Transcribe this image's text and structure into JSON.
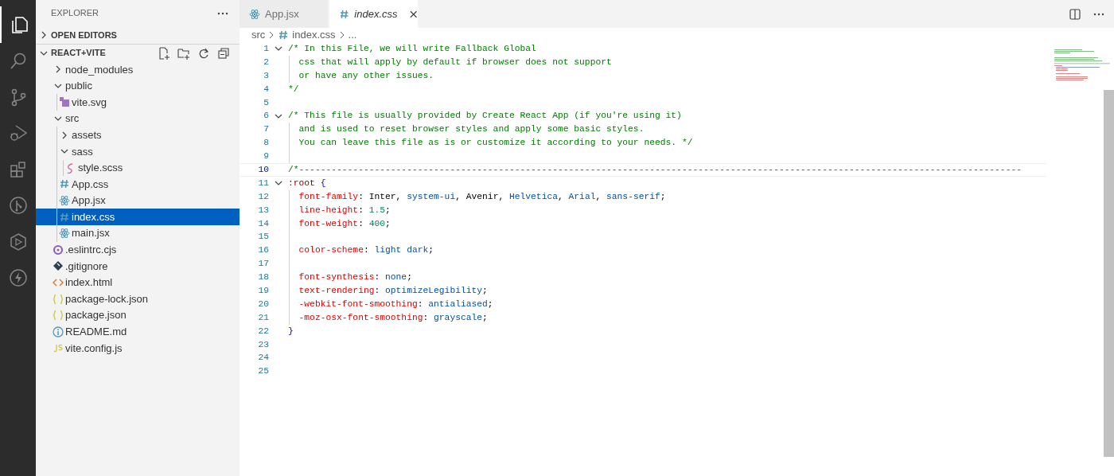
{
  "activity_bar": [
    {
      "kind": "files",
      "selected": true
    },
    {
      "kind": "search",
      "selected": false
    },
    {
      "kind": "source-control",
      "selected": false
    },
    {
      "kind": "run",
      "selected": false
    },
    {
      "kind": "extensions",
      "selected": false
    },
    {
      "kind": "git-graph",
      "selected": false
    },
    {
      "kind": "deploy",
      "selected": false
    },
    {
      "kind": "bolt",
      "selected": false
    }
  ],
  "sidebar": {
    "title": "EXPLORER",
    "sections": [
      {
        "label": "OPEN EDITORS",
        "expanded": false
      },
      {
        "label": "REACT+VITE",
        "expanded": true,
        "items": [
          {
            "label": "node_modules",
            "kind": "folder",
            "expanded": false,
            "selected": false
          },
          {
            "label": "public",
            "kind": "folder",
            "expanded": true,
            "selected": false,
            "children": [
              {
                "label": "vite.svg",
                "kind": "svg",
                "selected": false
              }
            ]
          },
          {
            "label": "src",
            "kind": "folder",
            "expanded": true,
            "selected": false,
            "children": [
              {
                "label": "assets",
                "kind": "folder",
                "expanded": false,
                "selected": false
              },
              {
                "label": "sass",
                "kind": "folder",
                "expanded": true,
                "selected": false,
                "children": [
                  {
                    "label": "style.scss",
                    "kind": "scss",
                    "selected": false
                  }
                ]
              },
              {
                "label": "App.css",
                "kind": "css",
                "selected": false
              },
              {
                "label": "App.jsx",
                "kind": "react",
                "selected": false
              },
              {
                "label": "index.css",
                "kind": "css",
                "selected": true
              },
              {
                "label": "main.jsx",
                "kind": "react",
                "selected": false
              }
            ]
          },
          {
            "label": ".eslintrc.cjs",
            "kind": "eslint",
            "selected": false
          },
          {
            "label": ".gitignore",
            "kind": "git",
            "selected": false
          },
          {
            "label": "index.html",
            "kind": "html",
            "selected": false
          },
          {
            "label": "package-lock.json",
            "kind": "json",
            "selected": false
          },
          {
            "label": "package.json",
            "kind": "json",
            "selected": false
          },
          {
            "label": "README.md",
            "kind": "info",
            "selected": false
          },
          {
            "label": "vite.config.js",
            "kind": "js",
            "selected": false
          }
        ]
      }
    ]
  },
  "tabs": [
    {
      "label": "App.jsx",
      "kind": "react",
      "selected": false,
      "preview": false
    },
    {
      "label": "index.css",
      "kind": "css",
      "selected": true,
      "preview": true
    }
  ],
  "breadcrumbs": [
    {
      "label": "src",
      "kind": "folder"
    },
    {
      "label": "index.css",
      "kind": "css"
    },
    {
      "label": "...",
      "kind": "more"
    }
  ],
  "code": [
    {
      "number": "1",
      "fold": true,
      "current": false,
      "tokens": [
        {
          "kind": "comment",
          "text": "/* In this File, we will write Fallback Global"
        }
      ]
    },
    {
      "number": "2",
      "fold": false,
      "current": false,
      "tokens": [
        {
          "kind": "comment",
          "text": "  css that will apply by default if browser does not support"
        }
      ]
    },
    {
      "number": "3",
      "fold": false,
      "current": false,
      "tokens": [
        {
          "kind": "comment",
          "text": "  or have any other issues."
        }
      ]
    },
    {
      "number": "4",
      "fold": false,
      "current": false,
      "tokens": [
        {
          "kind": "comment",
          "text": "*/"
        }
      ]
    },
    {
      "number": "5",
      "fold": false,
      "current": false
    },
    {
      "number": "6",
      "fold": true,
      "current": false,
      "tokens": [
        {
          "kind": "comment",
          "text": "/* This file is usually provided by Create React App (if you're using it)"
        }
      ]
    },
    {
      "number": "7",
      "fold": false,
      "current": false,
      "tokens": [
        {
          "kind": "comment",
          "text": "  and is used to reset browser styles and apply some basic styles."
        }
      ]
    },
    {
      "number": "8",
      "fold": false,
      "current": false,
      "tokens": [
        {
          "kind": "comment",
          "text": "  You can leave this file as is or customize it according to your needs. */"
        }
      ]
    },
    {
      "number": "9",
      "fold": false,
      "current": false
    },
    {
      "number": "10",
      "fold": false,
      "current": true,
      "tokens": [
        {
          "kind": "comment",
          "text": "/*--------------------------------------------------------------------------------------------------------------------------------------"
        }
      ]
    },
    {
      "number": "11",
      "fold": true,
      "current": false,
      "tokens": [
        {
          "kind": "selector",
          "text": ":root"
        },
        {
          "kind": "brace",
          "text": " {"
        }
      ]
    },
    {
      "number": "12",
      "fold": false,
      "current": false,
      "tokens": [
        {
          "kind": "property",
          "text": "  font-family"
        },
        {
          "kind": "plain",
          "text": ": Inter, "
        },
        {
          "kind": "keyword",
          "text": "system-ui"
        },
        {
          "kind": "plain",
          "text": ", Avenir, "
        },
        {
          "kind": "keyword",
          "text": "Helvetica"
        },
        {
          "kind": "plain",
          "text": ", "
        },
        {
          "kind": "keyword",
          "text": "Arial"
        },
        {
          "kind": "plain",
          "text": ", "
        },
        {
          "kind": "keyword",
          "text": "sans-serif"
        },
        {
          "kind": "plain",
          "text": ";"
        }
      ]
    },
    {
      "number": "13",
      "fold": false,
      "current": false,
      "tokens": [
        {
          "kind": "property",
          "text": "  line-height"
        },
        {
          "kind": "plain",
          "text": ": "
        },
        {
          "kind": "number",
          "text": "1.5"
        },
        {
          "kind": "plain",
          "text": ";"
        }
      ]
    },
    {
      "number": "14",
      "fold": false,
      "current": false,
      "tokens": [
        {
          "kind": "property",
          "text": "  font-weight"
        },
        {
          "kind": "plain",
          "text": ": "
        },
        {
          "kind": "number",
          "text": "400"
        },
        {
          "kind": "plain",
          "text": ";"
        }
      ]
    },
    {
      "number": "15",
      "fold": false,
      "current": false
    },
    {
      "number": "16",
      "fold": false,
      "current": false,
      "tokens": [
        {
          "kind": "property",
          "text": "  color-scheme"
        },
        {
          "kind": "plain",
          "text": ": "
        },
        {
          "kind": "keyword",
          "text": "light dark"
        },
        {
          "kind": "plain",
          "text": ";"
        }
      ]
    },
    {
      "number": "17",
      "fold": false,
      "current": false
    },
    {
      "number": "18",
      "fold": false,
      "current": false,
      "tokens": [
        {
          "kind": "property",
          "text": "  font-synthesis"
        },
        {
          "kind": "plain",
          "text": ": "
        },
        {
          "kind": "keyword",
          "text": "none"
        },
        {
          "kind": "plain",
          "text": ";"
        }
      ]
    },
    {
      "number": "19",
      "fold": false,
      "current": false,
      "tokens": [
        {
          "kind": "property",
          "text": "  text-rendering"
        },
        {
          "kind": "plain",
          "text": ": "
        },
        {
          "kind": "keyword",
          "text": "optimizeLegibility"
        },
        {
          "kind": "plain",
          "text": ";"
        }
      ]
    },
    {
      "number": "20",
      "fold": false,
      "current": false,
      "tokens": [
        {
          "kind": "property",
          "text": "  -webkit-font-smoothing"
        },
        {
          "kind": "plain",
          "text": ": "
        },
        {
          "kind": "keyword",
          "text": "antialiased"
        },
        {
          "kind": "plain",
          "text": ";"
        }
      ]
    },
    {
      "number": "21",
      "fold": false,
      "current": false,
      "tokens": [
        {
          "kind": "property",
          "text": "  -moz-osx-font-smoothing"
        },
        {
          "kind": "plain",
          "text": ": "
        },
        {
          "kind": "keyword",
          "text": "grayscale"
        },
        {
          "kind": "plain",
          "text": ";"
        }
      ]
    },
    {
      "number": "22",
      "fold": false,
      "current": false,
      "tokens": [
        {
          "kind": "brace",
          "text": "}"
        }
      ]
    },
    {
      "number": "23",
      "fold": false,
      "current": false
    },
    {
      "number": "24",
      "fold": false,
      "current": false
    },
    {
      "number": "25",
      "fold": false,
      "current": false
    }
  ]
}
